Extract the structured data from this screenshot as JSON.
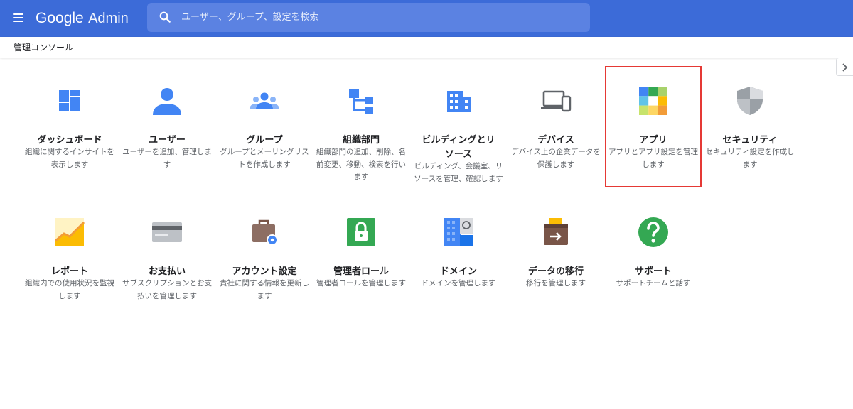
{
  "header": {
    "brand_google": "Google",
    "brand_admin": "Admin",
    "search_placeholder": "ユーザー、グループ、設定を検索"
  },
  "breadcrumb": "管理コンソール",
  "tiles": [
    {
      "title": "ダッシュボード",
      "desc": "組織に関するインサイトを表示します"
    },
    {
      "title": "ユーザー",
      "desc": "ユーザーを追加、管理します"
    },
    {
      "title": "グループ",
      "desc": "グループとメーリングリストを作成します"
    },
    {
      "title": "組織部門",
      "desc": "組織部門の追加、削除、名前変更、移動、検索を行います"
    },
    {
      "title": "ビルディングとリソース",
      "desc": "ビルディング、会議室、リソースを管理、確認します"
    },
    {
      "title": "デバイス",
      "desc": "デバイス上の企業データを保護します"
    },
    {
      "title": "アプリ",
      "desc": "アプリとアプリ設定を管理します"
    },
    {
      "title": "セキュリティ",
      "desc": "セキュリティ設定を作成します"
    },
    {
      "title": "レポート",
      "desc": "組織内での使用状況を監視します"
    },
    {
      "title": "お支払い",
      "desc": "サブスクリプションとお支払いを管理します"
    },
    {
      "title": "アカウント設定",
      "desc": "貴社に関する情報を更新します"
    },
    {
      "title": "管理者ロール",
      "desc": "管理者ロールを管理します"
    },
    {
      "title": "ドメイン",
      "desc": "ドメインを管理します"
    },
    {
      "title": "データの移行",
      "desc": "移行を管理します"
    },
    {
      "title": "サポート",
      "desc": "サポートチームと話す"
    }
  ],
  "colors": {
    "header": "#3c6bd8",
    "icon_blue": "#4285f4",
    "highlight": "#e53935"
  }
}
